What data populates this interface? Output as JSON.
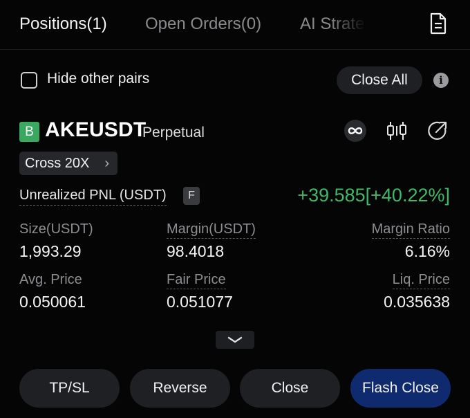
{
  "tabs": [
    {
      "label": "Positions(1)",
      "active": true
    },
    {
      "label": "Open Orders(0)",
      "active": false
    },
    {
      "label": "AI Strate",
      "active": false
    }
  ],
  "icons": {
    "document": "document-icon",
    "info": "info-icon",
    "infinite": "infinite-icon",
    "chart": "candlestick-chart-icon",
    "share": "share-icon",
    "expand": "chevron-down-icon"
  },
  "filter": {
    "hide_other_pairs_label": "Hide other pairs",
    "hide_other_pairs_checked": false,
    "close_all_label": "Close All",
    "info_glyph": "i"
  },
  "position": {
    "side_badge": "B",
    "symbol": "AKEUSDT",
    "contract_type": "Perpetual",
    "leverage": "Cross 20X",
    "leverage_chevron": "›",
    "pnl_label": "Unrealized PNL (USDT)",
    "pnl_flag": "F",
    "pnl_value": "+39.585[+40.22%]",
    "size_label": "Size(USDT)",
    "size_value": "1,993.29",
    "margin_label": "Margin(USDT)",
    "margin_value": "98.4018",
    "margin_ratio_label": "Margin Ratio",
    "margin_ratio_value": "6.16%",
    "avg_price_label": "Avg. Price",
    "avg_price_value": "0.050061",
    "fair_price_label": "Fair Price",
    "fair_price_value": "0.051077",
    "liq_price_label": "Liq. Price",
    "liq_price_value": "0.035638"
  },
  "actions": {
    "tpsl": "TP/SL",
    "reverse": "Reverse",
    "close": "Close",
    "flash_close": "Flash Close"
  },
  "colors": {
    "background": "#050505",
    "profit_green": "#3fb868",
    "buy_badge": "#3aa860",
    "flash_close_bg": "#0f2a6e",
    "button_bg": "#1f2023"
  }
}
